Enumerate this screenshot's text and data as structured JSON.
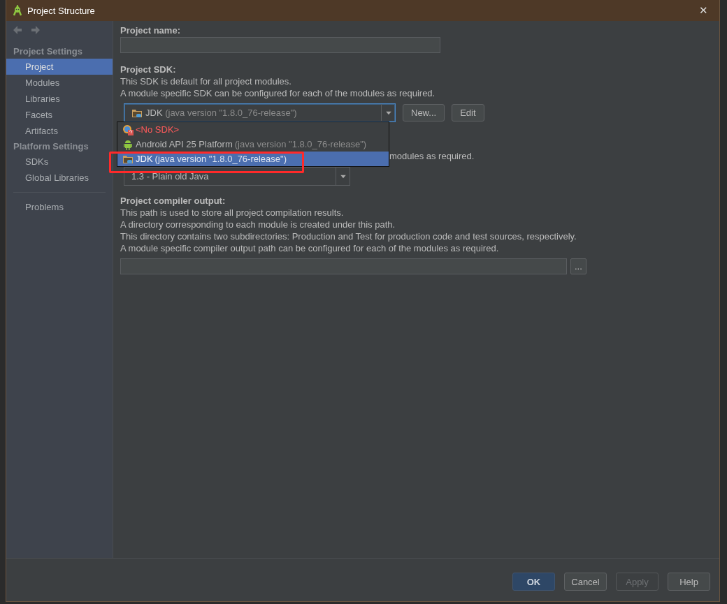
{
  "window": {
    "title": "Project Structure",
    "close": "✕"
  },
  "sidebar": {
    "sections": [
      {
        "heading": "Project Settings",
        "items": [
          {
            "label": "Project",
            "selected": true
          },
          {
            "label": "Modules",
            "selected": false
          },
          {
            "label": "Libraries",
            "selected": false
          },
          {
            "label": "Facets",
            "selected": false
          },
          {
            "label": "Artifacts",
            "selected": false
          }
        ]
      },
      {
        "heading": "Platform Settings",
        "items": [
          {
            "label": "SDKs",
            "selected": false
          },
          {
            "label": "Global Libraries",
            "selected": false
          }
        ]
      }
    ],
    "extra_items": [
      {
        "label": "Problems",
        "selected": false
      }
    ]
  },
  "project_name": {
    "label": "Project name:"
  },
  "project_sdk": {
    "label": "Project SDK:",
    "description": [
      "This SDK is default for all project modules.",
      "A module specific SDK can be configured for each of the modules as required."
    ],
    "value": {
      "kind": "jdk",
      "name": "JDK",
      "detail": "(java version \"1.8.0_76-release\")"
    },
    "buttons": [
      "New...",
      "Edit"
    ],
    "options": [
      {
        "kind": "none",
        "name": "<No SDK>",
        "selected": false
      },
      {
        "kind": "android",
        "name": "Android API 25 Platform",
        "detail": "(java version \"1.8.0_76-release\")",
        "selected": false
      },
      {
        "kind": "jdk",
        "name": "JDK",
        "detail": "(java version \"1.8.0_76-release\")",
        "selected": true
      }
    ]
  },
  "language_level": {
    "description_tail": "modules as required.",
    "value": "1.3 - Plain old Java"
  },
  "compiler_output": {
    "label": "Project compiler output:",
    "description": [
      "This path is used to store all project compilation results.",
      "A directory corresponding to each module is created under this path.",
      "This directory contains two subdirectories: Production and Test for production code and test sources, respectively.",
      "A module specific compiler output path can be configured for each of the modules as required."
    ],
    "browse": "..."
  },
  "buttons": [
    {
      "label": "OK",
      "kind": "default",
      "disabled": false
    },
    {
      "label": "Cancel",
      "kind": "normal",
      "disabled": false
    },
    {
      "label": "Apply",
      "kind": "normal",
      "disabled": true
    },
    {
      "label": "Help",
      "kind": "normal",
      "disabled": false
    }
  ]
}
